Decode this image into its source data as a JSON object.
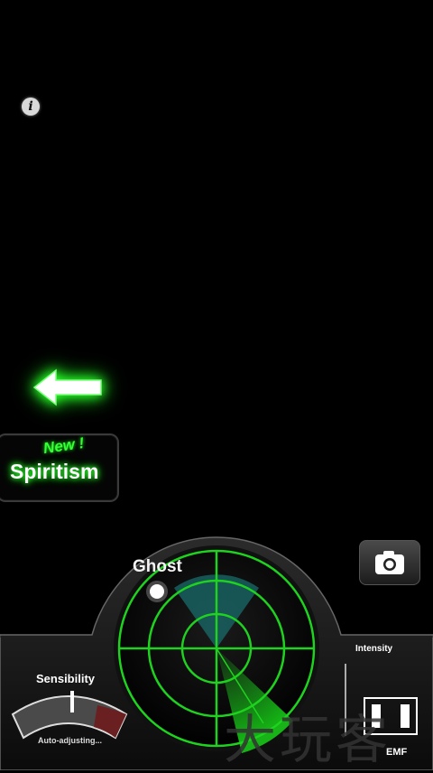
{
  "top_bar": {
    "info_icon": "info-icon"
  },
  "nav": {
    "back_arrow_icon": "left-arrow-icon",
    "arrow_color": "#1cff1c"
  },
  "spiritism": {
    "badge": "New !",
    "label": "Spiritism"
  },
  "radar": {
    "ghost_label": "Ghost",
    "accent_color": "#1fd21f"
  },
  "camera": {
    "icon": "camera-icon"
  },
  "meters": {
    "intensity_label": "Intensity",
    "sensibility_label": "Sensibility",
    "auto_label": "Auto-adjusting...",
    "emf_label": "EMF"
  },
  "watermark": {
    "text": "大玩客"
  }
}
